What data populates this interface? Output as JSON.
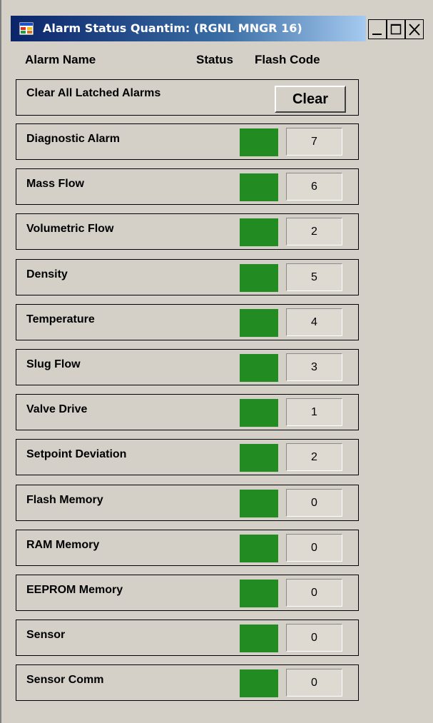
{
  "window": {
    "title": "Alarm Status Quantim: (RGNL MNGR 16)",
    "icon": "app-window-icon"
  },
  "header": {
    "alarm_name": "Alarm Name",
    "status": "Status",
    "flash_code": "Flash Code"
  },
  "clear_row": {
    "label": "Clear All Latched Alarms",
    "button_label": "Clear"
  },
  "colors": {
    "status_ok": "#228b22",
    "background": "#d4d0c8"
  },
  "alarms": [
    {
      "name": "Diagnostic Alarm",
      "status": "ok",
      "flash_code": "7"
    },
    {
      "name": "Mass Flow",
      "status": "ok",
      "flash_code": "6"
    },
    {
      "name": "Volumetric Flow",
      "status": "ok",
      "flash_code": "2"
    },
    {
      "name": "Density",
      "status": "ok",
      "flash_code": "5"
    },
    {
      "name": "Temperature",
      "status": "ok",
      "flash_code": "4"
    },
    {
      "name": "Slug Flow",
      "status": "ok",
      "flash_code": "3"
    },
    {
      "name": "Valve Drive",
      "status": "ok",
      "flash_code": "1"
    },
    {
      "name": "Setpoint Deviation",
      "status": "ok",
      "flash_code": "2"
    },
    {
      "name": "Flash Memory",
      "status": "ok",
      "flash_code": "0"
    },
    {
      "name": "RAM Memory",
      "status": "ok",
      "flash_code": "0"
    },
    {
      "name": "EEPROM Memory",
      "status": "ok",
      "flash_code": "0"
    },
    {
      "name": "Sensor",
      "status": "ok",
      "flash_code": "0"
    },
    {
      "name": "Sensor Comm",
      "status": "ok",
      "flash_code": "0"
    }
  ]
}
